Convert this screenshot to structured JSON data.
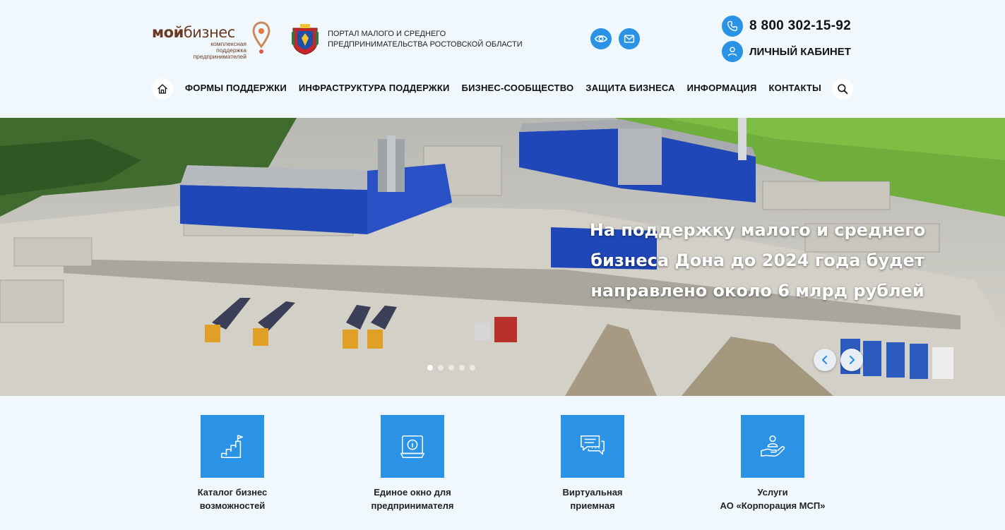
{
  "header": {
    "logo": {
      "word_bold": "мой",
      "word_light": "бизнес",
      "tagline": "комплексная поддержка предпринимателей"
    },
    "portal_title": "ПОРТАЛ МАЛОГО И СРЕДНЕГО ПРЕДПРИНИМАТЕЛЬСТВА РОСТОВСКОЙ ОБЛАСТИ",
    "accessibility_icon": "eye-icon",
    "mail_icon": "mail-icon",
    "phone": "8 800 302-15-92",
    "cabinet": "ЛИЧНЫЙ КАБИНЕТ"
  },
  "nav": {
    "home_icon": "home-icon",
    "items": [
      "ФОРМЫ ПОДДЕРЖКИ",
      "ИНФРАСТРУКТУРА ПОДДЕРЖКИ",
      "БИЗНЕС-СООБЩЕСТВО",
      "ЗАЩИТА БИЗНЕСА",
      "ИНФОРМАЦИЯ",
      "КОНТАКТЫ"
    ],
    "search_icon": "search-icon"
  },
  "hero": {
    "title": "На поддержку малого и среднего бизнеса Дона до 2024 года будет направлено около 6 млрд рублей",
    "slides_total": 5,
    "active_slide": 1
  },
  "services": [
    {
      "label": "Каталог бизнес\nвозможностей",
      "icon": "growth-stairs-icon"
    },
    {
      "label": "Единое окно для\nпредпринимателя",
      "icon": "info-window-icon"
    },
    {
      "label": "Виртуальная\nприемная",
      "icon": "chat-icon"
    },
    {
      "label": "Услуги\nАО «Корпорация МСП»",
      "icon": "hand-support-icon"
    }
  ],
  "colors": {
    "accent": "#2a93e5",
    "background": "#f1f8fd",
    "logo_brown": "#6a3a20",
    "logo_orange": "#e27a3f"
  }
}
